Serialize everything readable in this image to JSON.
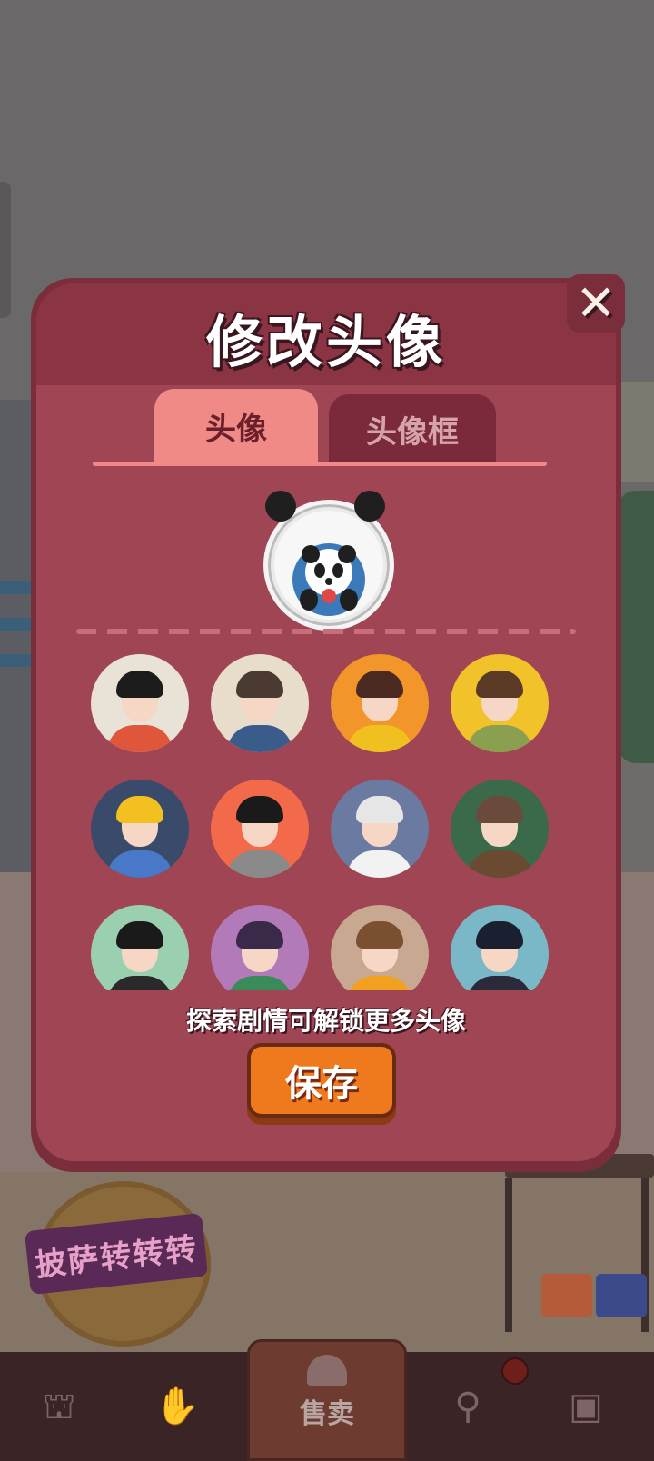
{
  "background": {
    "wheel_logo_text": "披萨转转转"
  },
  "modal": {
    "title": "修改头像",
    "close_label": "✕",
    "tabs": [
      {
        "label": "头像",
        "active": true
      },
      {
        "label": "头像框",
        "active": false
      }
    ],
    "selected_avatar": "panda-avatar",
    "avatars": [
      {
        "name": "girl-braid-avatar",
        "bg": "#e9e2d6",
        "hair": "#1c1c1c",
        "body": "#e0563a"
      },
      {
        "name": "boy-glasses-avatar",
        "bg": "#e8dccb",
        "hair": "#4a3a32",
        "body": "#3a5c8a"
      },
      {
        "name": "girl-orange-avatar",
        "bg": "#f2952a",
        "hair": "#4a2a20",
        "body": "#f0c020"
      },
      {
        "name": "girl-yellow-avatar",
        "bg": "#f2c22a",
        "hair": "#5a3a24",
        "body": "#8aa050"
      },
      {
        "name": "boy-hardhat-avatar",
        "bg": "#3a4a6a",
        "hair": "#f2c020",
        "body": "#4a78c8"
      },
      {
        "name": "girl-bob-avatar",
        "bg": "#f26a4a",
        "hair": "#1a1a1a",
        "body": "#8a8a8a"
      },
      {
        "name": "old-man-avatar",
        "bg": "#6a7aa0",
        "hair": "#e6e6e6",
        "body": "#f2f2f2"
      },
      {
        "name": "man-beret-avatar",
        "bg": "#3a6a4a",
        "hair": "#6a4a3a",
        "body": "#6a4a30"
      },
      {
        "name": "man-sunglasses-avatar",
        "bg": "#9ad0b0",
        "hair": "#1a1a1a",
        "body": "#2a2a2a"
      },
      {
        "name": "girl-purple-avatar",
        "bg": "#b27ab8",
        "hair": "#3a2a4a",
        "body": "#3a8a5a"
      },
      {
        "name": "boy-brown-avatar",
        "bg": "#c8a890",
        "hair": "#7a5030",
        "body": "#f2a020"
      },
      {
        "name": "girl-longhair-avatar",
        "bg": "#7ab8c8",
        "hair": "#1a2030",
        "body": "#2a2a3a"
      }
    ],
    "unlock_hint": "探索剧情可解锁更多头像",
    "save_label": "保存"
  },
  "bottom_nav": {
    "items": [
      {
        "name": "bag-icon",
        "glyph": "⛫"
      },
      {
        "name": "handshake-icon",
        "glyph": "✋"
      },
      {
        "name": "sell-bell-icon",
        "label": "售卖"
      },
      {
        "name": "map-person-icon",
        "glyph": "⚲"
      },
      {
        "name": "bus-icon",
        "glyph": "▣"
      }
    ]
  },
  "colors": {
    "modal_border": "#7a2d3a",
    "modal_fill": "#9f4553",
    "tab_active": "#f08a86",
    "save_button": "#ef7a1e"
  }
}
